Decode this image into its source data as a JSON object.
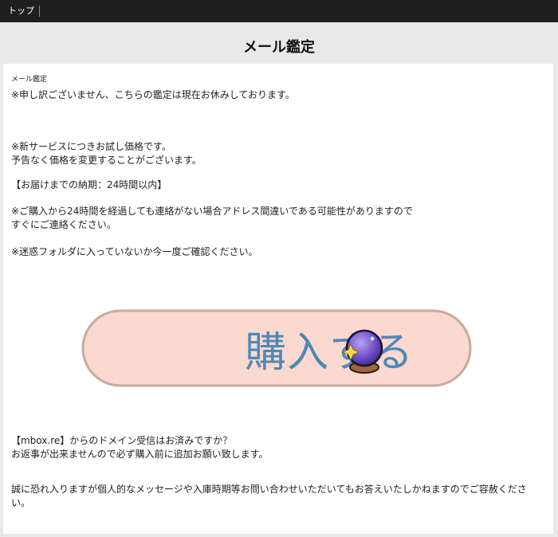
{
  "topbar": {
    "breadcrumb": "トップ"
  },
  "page": {
    "title": "メール鑑定"
  },
  "content": {
    "small_label": "メール鑑定",
    "notice": "※申し訳ございません、こちらの鑑定は現在お休みしております。",
    "trial_line1": "※新サービスにつきお試し価格です。",
    "trial_line2": "予告なく価格を変更することがございます。",
    "delivery": "【お届けまでの納期：24時間以内】",
    "contact_line1": "※ご購入から24時間を経過しても連絡がない場合アドレス間違いである可能性がありますので",
    "contact_line2": "すぐにご連絡ください。",
    "spam": "※迷惑フォルダに入っていないか今一度ご確認ください。",
    "buy_button_label": "購入する",
    "buy_button_icon": "crystal-ball-icon",
    "domain_line1": "【mbox.re】からのドメイン受信はお済みですか？",
    "domain_line2": "お返事が出来ませんので必ず購入前に追加お願い致します。",
    "disclaimer": "誠に恐れ入りますが個人的なメッセージや入庫時期等お問い合わせいただいてもお答えいたしかねますのでご容赦ください。"
  },
  "colors": {
    "button_fill": "#fbd9cf",
    "button_border": "#c9a9a0",
    "button_text": "#4f87b8",
    "topbar": "#1f1f1f"
  }
}
